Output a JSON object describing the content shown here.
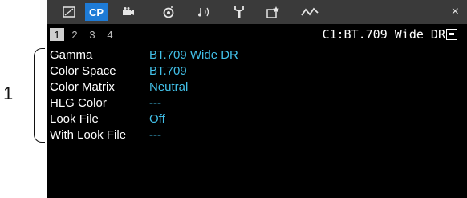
{
  "callout": {
    "number": "1"
  },
  "tabs": [
    {
      "name": "camera-setup-tab",
      "icon": "screen-icon",
      "label": ""
    },
    {
      "name": "custom-picture-tab",
      "icon": "",
      "label": "CP"
    },
    {
      "name": "recording-tab",
      "icon": "film-camera-icon",
      "label": ""
    },
    {
      "name": "assist-tab",
      "icon": "focus-assist-icon",
      "label": ""
    },
    {
      "name": "audio-tab",
      "icon": "audio-icon",
      "label": ""
    },
    {
      "name": "system-tab",
      "icon": "wrench-icon",
      "label": ""
    },
    {
      "name": "my-menu-tab",
      "icon": "my-menu-icon",
      "label": ""
    },
    {
      "name": "network-tab",
      "icon": "network-wave-icon",
      "label": ""
    }
  ],
  "close_label": "×",
  "pages": [
    "1",
    "2",
    "3",
    "4"
  ],
  "status": {
    "text": "C1:BT.709 Wide DR",
    "icon": "file-icon"
  },
  "menu_items": [
    {
      "label": "Gamma",
      "value": "BT.709 Wide DR"
    },
    {
      "label": "Color Space",
      "value": "BT.709"
    },
    {
      "label": "Color Matrix",
      "value": "Neutral"
    },
    {
      "label": "HLG Color",
      "value": "---"
    },
    {
      "label": "Look File",
      "value": "Off"
    },
    {
      "label": "With Look File",
      "value": "---"
    }
  ],
  "colors": {
    "active_tab": "#1e7bd6",
    "value_text": "#42c0e8",
    "background": "#000000"
  }
}
